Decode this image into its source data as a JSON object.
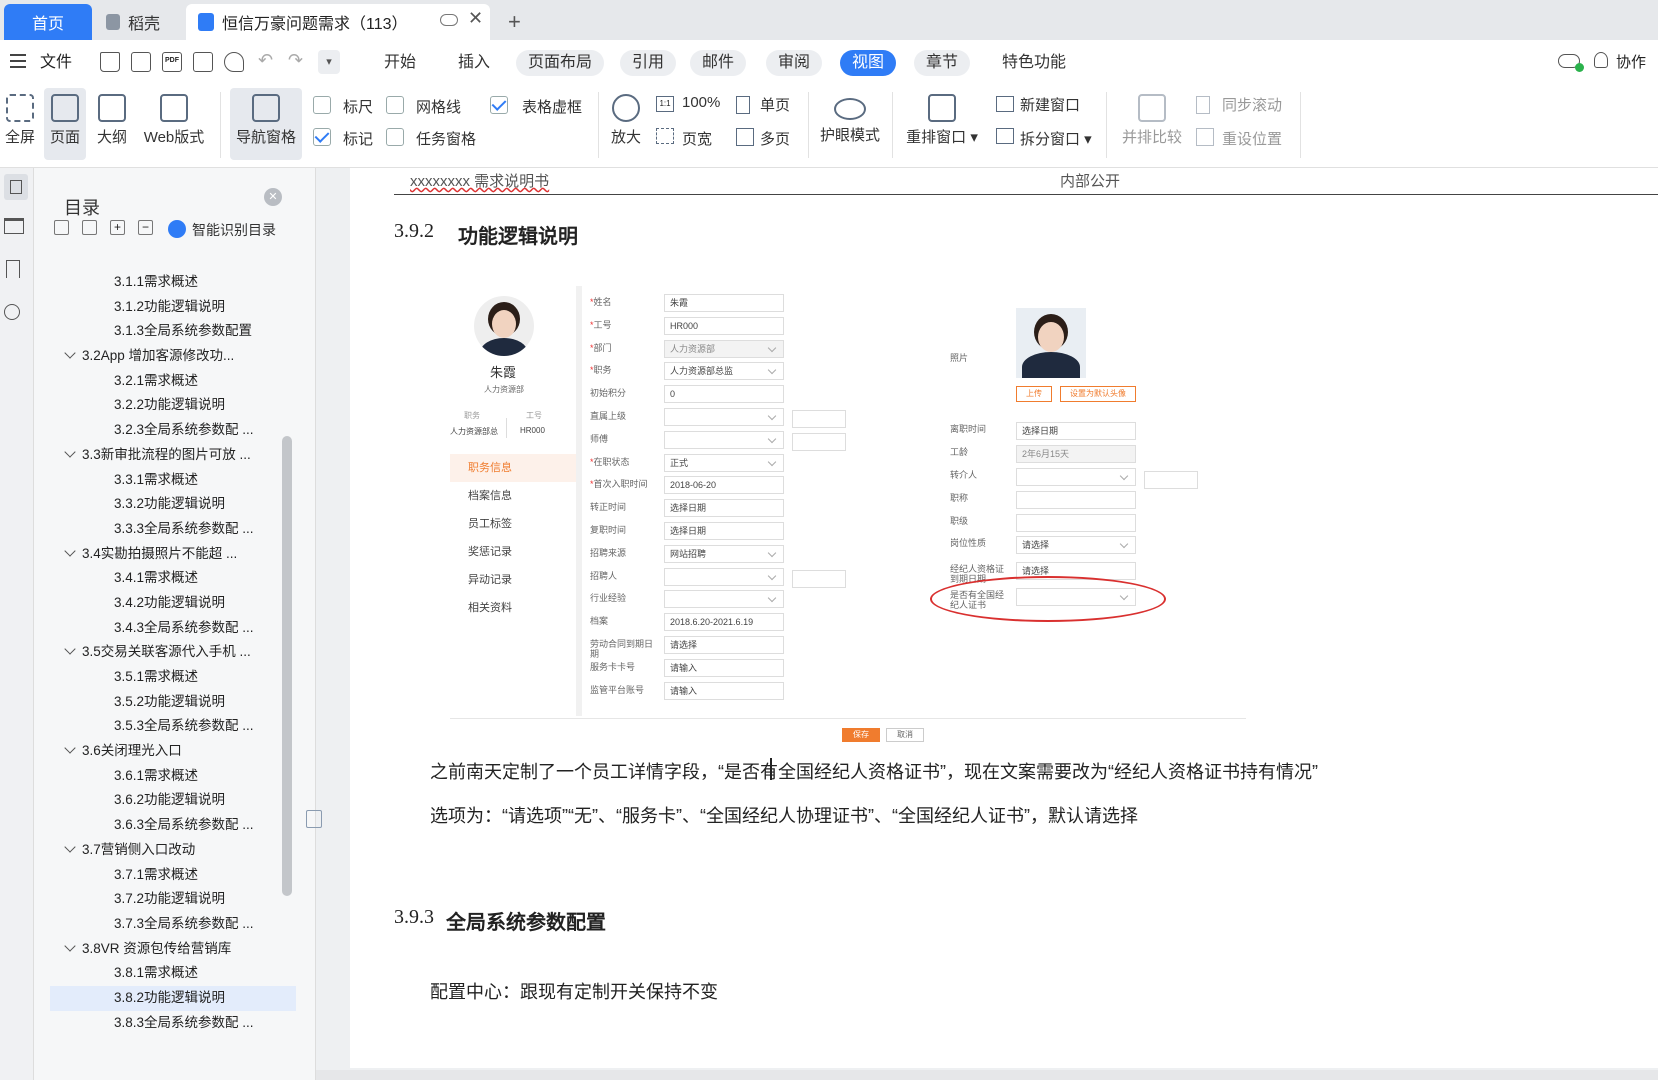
{
  "tabs": {
    "home": "首页",
    "draft": "稻壳",
    "doc": "恒信万豪问题需求（113）",
    "add": "+"
  },
  "menu": {
    "file": "文件",
    "items": [
      "开始",
      "插入",
      "页面布局",
      "引用",
      "邮件",
      "审阅",
      "视图",
      "章节",
      "特色功能"
    ],
    "active": "视图",
    "collab": "协作"
  },
  "ribbon": {
    "fullscreen": "全屏",
    "page": "页面",
    "outline": "大纲",
    "web": "Web版式",
    "nav": "导航窗格",
    "ruler": "标尺",
    "gridline": "网格线",
    "tableframe": "表格虚框",
    "mark": "标记",
    "taskpane": "任务窗格",
    "zoom": "放大",
    "zoom100": "100%",
    "pagewidth": "页宽",
    "single": "单页",
    "multi": "多页",
    "eyecare": "护眼模式",
    "rearrange": "重排窗口",
    "newwin": "新建窗口",
    "splitwin": "拆分窗口",
    "sidebyside": "并排比较",
    "syncscroll": "同步滚动",
    "resetpos": "重设位置"
  },
  "toc": {
    "title": "目录",
    "smart": "智能识别目录",
    "items": [
      {
        "t": "3.1.1需求概述",
        "l": 2
      },
      {
        "t": "3.1.2功能逻辑说明",
        "l": 2
      },
      {
        "t": "3.1.3全局系统参数配置",
        "l": 2
      },
      {
        "t": "3.2App 增加客源修改功...",
        "l": 1
      },
      {
        "t": "3.2.1需求概述",
        "l": 2
      },
      {
        "t": "3.2.2功能逻辑说明",
        "l": 2
      },
      {
        "t": "3.2.3全局系统参数配 ...",
        "l": 2
      },
      {
        "t": "3.3新审批流程的图片可放 ...",
        "l": 1
      },
      {
        "t": "3.3.1需求概述",
        "l": 2
      },
      {
        "t": "3.3.2功能逻辑说明",
        "l": 2
      },
      {
        "t": "3.3.3全局系统参数配 ...",
        "l": 2
      },
      {
        "t": "3.4实勘拍摄照片不能超 ...",
        "l": 1
      },
      {
        "t": "3.4.1需求概述",
        "l": 2
      },
      {
        "t": "3.4.2功能逻辑说明",
        "l": 2
      },
      {
        "t": "3.4.3全局系统参数配 ...",
        "l": 2
      },
      {
        "t": "3.5交易关联客源代入手机 ...",
        "l": 1
      },
      {
        "t": "3.5.1需求概述",
        "l": 2
      },
      {
        "t": "3.5.2功能逻辑说明",
        "l": 2
      },
      {
        "t": "3.5.3全局系统参数配 ...",
        "l": 2
      },
      {
        "t": "3.6关闭理光入口",
        "l": 1
      },
      {
        "t": "3.6.1需求概述",
        "l": 2
      },
      {
        "t": "3.6.2功能逻辑说明",
        "l": 2
      },
      {
        "t": "3.6.3全局系统参数配 ...",
        "l": 2
      },
      {
        "t": "3.7营销侧入口改动",
        "l": 1
      },
      {
        "t": "3.7.1需求概述",
        "l": 2
      },
      {
        "t": "3.7.2功能逻辑说明",
        "l": 2
      },
      {
        "t": "3.7.3全局系统参数配 ...",
        "l": 2
      },
      {
        "t": "3.8VR 资源包传给营销库",
        "l": 1
      },
      {
        "t": "3.8.1需求概述",
        "l": 2
      },
      {
        "t": "3.8.2功能逻辑说明",
        "l": 2,
        "sel": true
      },
      {
        "t": "3.8.3全局系统参数配 ...",
        "l": 2
      }
    ]
  },
  "doc": {
    "header_left": "xxxxxxxx 需求说明书",
    "header_right": "内部公开",
    "h392": "3.9.2",
    "h392_title": "功能逻辑说明",
    "para1": "之前南天定制了一个员工详情字段，“是否有全国经纪人资格证书”，现在文案需要改为“经纪人资格证书持有情况”",
    "para2": "选项为：“请选项”“无”、“服务卡”、“全国经纪人协理证书”、“全国经纪人证书”，默认请选择",
    "h393": "3.9.3",
    "h393_title": "全局系统参数配置",
    "para3": "配置中心：跟现有定制开关保持不变"
  },
  "figure": {
    "name": "朱霞",
    "dept": "人力资源部",
    "role_label": "职务",
    "role_val": "人力资源部总",
    "id_label": "工号",
    "id_val": "HR000",
    "side_menu": [
      "职务信息",
      "档案信息",
      "员工标签",
      "奖惩记录",
      "异动记录",
      "相关资料"
    ],
    "fields": [
      {
        "l": "姓名",
        "v": "朱霞",
        "req": true
      },
      {
        "l": "工号",
        "v": "HR000",
        "req": true
      },
      {
        "l": "部门",
        "v": "人力资源部",
        "req": true,
        "dd": true,
        "g": true
      },
      {
        "l": "职务",
        "v": "人力资源部总监",
        "req": true,
        "dd": true
      },
      {
        "l": "初始积分",
        "v": "0"
      },
      {
        "l": "直属上级",
        "v": "",
        "dd": true
      },
      {
        "l": "师傅",
        "v": "",
        "dd": true
      },
      {
        "l": "在职状态",
        "v": "正式",
        "req": true,
        "dd": true
      },
      {
        "l": "首次入职时间",
        "v": "2018-06-20",
        "req": true
      },
      {
        "l": "转正时间",
        "v": "选择日期"
      },
      {
        "l": "复职时间",
        "v": "选择日期"
      },
      {
        "l": "招聘来源",
        "v": "网站招聘",
        "dd": true
      },
      {
        "l": "招聘人",
        "v": "",
        "dd": true
      },
      {
        "l": "行业经验",
        "v": "",
        "dd": true
      },
      {
        "l": "档案",
        "v": "2018.6.20-2021.6.19"
      },
      {
        "l": "劳动合同到期日期",
        "v": "请选择"
      },
      {
        "l": "服务卡卡号",
        "v": "请输入"
      },
      {
        "l": "监管平台账号",
        "v": "请输入"
      }
    ],
    "photo_label": "照片",
    "upload": "上传",
    "set_default": "设置为默认头像",
    "right_fields": [
      {
        "l": "离职时间",
        "v": "选择日期"
      },
      {
        "l": "工龄",
        "v": "2年6月15天",
        "g": true
      },
      {
        "l": "转介人",
        "v": "",
        "dd": true
      },
      {
        "l": "职称",
        "v": ""
      },
      {
        "l": "职级",
        "v": ""
      },
      {
        "l": "岗位性质",
        "v": "请选择",
        "dd": true
      },
      {
        "l": "经纪人资格证到期日期",
        "v": "请选择"
      },
      {
        "l": "是否有全国经纪人证书",
        "v": "",
        "dd": true
      }
    ],
    "btn_save": "保存",
    "btn_cancel": "取消"
  },
  "colors": {
    "accent": "#2f7cf6",
    "highlight_circle": "#d9302f",
    "orange": "#f07c2e"
  }
}
